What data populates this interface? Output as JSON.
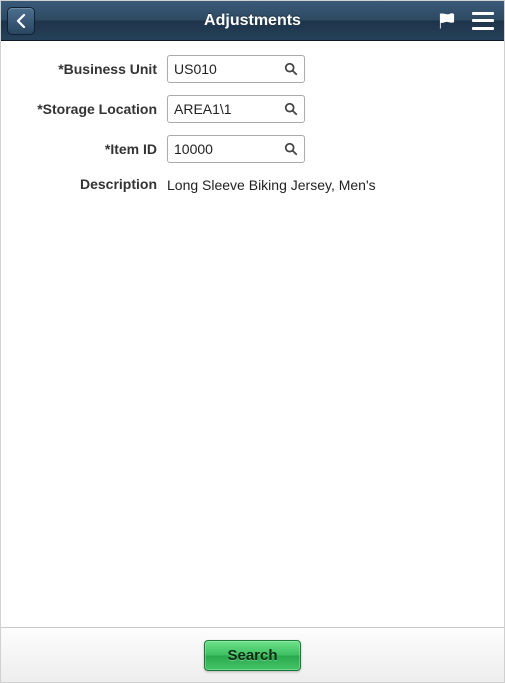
{
  "header": {
    "title": "Adjustments"
  },
  "form": {
    "business_unit": {
      "label": "*Business Unit",
      "value": "US010"
    },
    "storage_location": {
      "label": "*Storage Location",
      "value": "AREA1\\1"
    },
    "item_id": {
      "label": "*Item ID",
      "value": "10000"
    },
    "description": {
      "label": "Description",
      "value": "Long Sleeve Biking Jersey, Men's"
    }
  },
  "footer": {
    "search_label": "Search"
  }
}
